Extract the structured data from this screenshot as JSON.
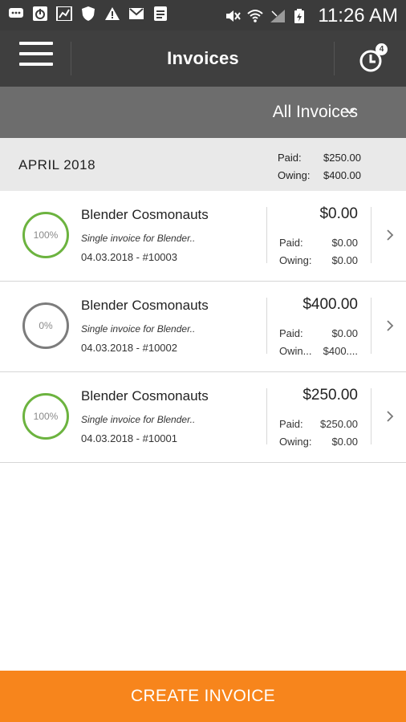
{
  "status_bar": {
    "time": "11:26 AM",
    "left_icons": [
      "message-icon",
      "power-icon",
      "chart-icon",
      "shield-icon",
      "warning-icon",
      "mail-icon",
      "note-icon"
    ],
    "right_icons": [
      "mute-icon",
      "wifi-icon",
      "signal-icon",
      "battery-icon"
    ]
  },
  "app_bar": {
    "title": "Invoices",
    "history_badge": "4"
  },
  "filter": {
    "selected": "All Invoices"
  },
  "month": {
    "label": "APRIL  2018",
    "paid_label": "Paid:",
    "paid_value": "$250.00",
    "owing_label": "Owing:",
    "owing_value": "$400.00"
  },
  "invoices": [
    {
      "progress_text": "100%",
      "client": "Blender Cosmonauts",
      "description": "Single invoice for Blender..",
      "meta": "04.03.2018 - #10003",
      "total": "$0.00",
      "paid_label": "Paid:",
      "paid_value": "$0.00",
      "owing_label": "Owing:",
      "owing_value": "$0.00"
    },
    {
      "progress_text": "0%",
      "client": "Blender Cosmonauts",
      "description": "Single invoice for Blender..",
      "meta": "04.03.2018 - #10002",
      "total": "$400.00",
      "paid_label": "Paid:",
      "paid_value": "$0.00",
      "owing_label": "Owin...",
      "owing_value": "$400...."
    },
    {
      "progress_text": "100%",
      "client": "Blender Cosmonauts",
      "description": "Single invoice for Blender..",
      "meta": "04.03.2018 - #10001",
      "total": "$250.00",
      "paid_label": "Paid:",
      "paid_value": "$250.00",
      "owing_label": "Owing:",
      "owing_value": "$0.00"
    }
  ],
  "cta": {
    "label": "CREATE INVOICE"
  },
  "colors": {
    "status_bar": "#3b3b3b",
    "app_bar": "#3f3f3f",
    "filter_bar": "#6d6d6d",
    "month_bar": "#e9e9e9",
    "progress_complete": "#6cb33f",
    "progress_none": "#7c7c7c",
    "cta": "#f7851c"
  }
}
